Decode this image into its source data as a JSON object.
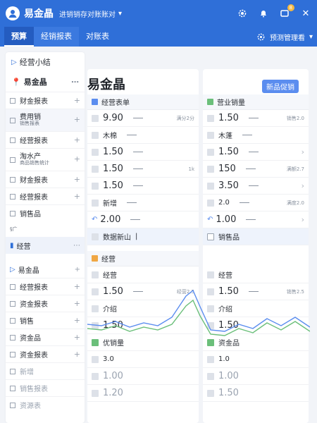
{
  "header": {
    "app_title": "易金晶",
    "subtitle": "进销销存对账账对",
    "notif_badge": "8"
  },
  "tabs": [
    "预算",
    "经销报表",
    "对账表"
  ],
  "tabbar_right": "预测管理看",
  "sidebar": {
    "head": "经营小结",
    "section_title": "易金晶",
    "items": [
      {
        "label": "财金报表"
      },
      {
        "label": "费用销",
        "sub": "销售报表"
      },
      {
        "label": "经营报表"
      },
      {
        "label": "淘水产",
        "sub": "商品销售统计"
      },
      {
        "label": "财金报表"
      },
      {
        "label": "经营报表"
      },
      {
        "label": "销售品"
      }
    ],
    "foot_label": "经营",
    "group_label": "经营",
    "groups": [
      {
        "label": "易金晶"
      },
      {
        "label": "经营报表"
      },
      {
        "label": "资金报表"
      },
      {
        "label": "销售"
      },
      {
        "label": "资金品"
      },
      {
        "label": "资金报表"
      },
      {
        "label": "新增"
      },
      {
        "label": "销售报表"
      },
      {
        "label": "资源表"
      }
    ]
  },
  "center": {
    "big_title": "易金晶",
    "head": "经营表单",
    "rows": [
      "9.90",
      "木棉",
      "1.50",
      "1.50",
      "1.50",
      "新增",
      "2.00",
      "数据新山"
    ],
    "row_notes": [
      "满分2分",
      "",
      "",
      "1k",
      "",
      "",
      "",
      ""
    ],
    "section2": "经营",
    "rows2": [
      "经营",
      "1.50",
      "介绍",
      "1.50",
      "优销量",
      "3.0",
      "1.00",
      "1.20"
    ],
    "rows2_notes": [
      "",
      "经营2.5",
      "",
      "",
      "",
      "",
      "",
      ""
    ]
  },
  "right": {
    "notice": "新品促销",
    "head": "营业销量",
    "rows": [
      "1.50",
      "木蓬",
      "1.50",
      "150",
      "3.50",
      "2.0",
      "1.00",
      "销售品"
    ],
    "row_notes": [
      "销售2.0",
      "",
      "",
      "满额2.7",
      "",
      "满度2.0",
      "",
      ""
    ],
    "rows2": [
      "经营",
      "1.50",
      "介绍",
      "1.50",
      "资金品",
      "1.0",
      "1.00",
      "1.50"
    ],
    "rows2_notes": [
      "",
      "销售2.5",
      "",
      "",
      "",
      "",
      "",
      ""
    ]
  },
  "colors": {
    "primary": "#2f6fd8",
    "accent": "#5b8def"
  }
}
